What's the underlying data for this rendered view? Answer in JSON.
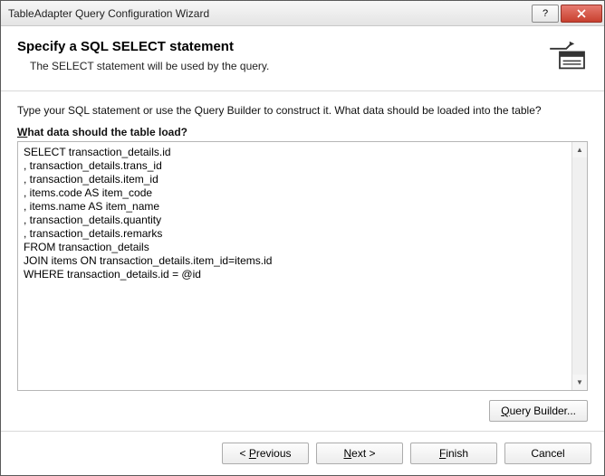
{
  "window": {
    "title": "TableAdapter Query Configuration Wizard"
  },
  "header": {
    "title": "Specify a SQL SELECT statement",
    "subtitle": "The SELECT statement will be used by the query."
  },
  "body": {
    "instruction": "Type your SQL statement or use the Query Builder to construct it. What data should be loaded into the table?",
    "field_label_pre": "W",
    "field_label_rest": "hat data should the table load?",
    "sql": "SELECT transaction_details.id\n, transaction_details.trans_id\n, transaction_details.item_id\n, items.code AS item_code\n, items.name AS item_name\n, transaction_details.quantity\n, transaction_details.remarks\nFROM transaction_details\nJOIN items ON transaction_details.item_id=items.id\nWHERE transaction_details.id = @id",
    "query_builder_pre": "Q",
    "query_builder_rest": "uery Builder..."
  },
  "footer": {
    "previous_pre": "< ",
    "previous_u": "P",
    "previous_rest": "revious",
    "next_u": "N",
    "next_rest": "ext >",
    "finish_u": "F",
    "finish_rest": "inish",
    "cancel": "Cancel"
  }
}
